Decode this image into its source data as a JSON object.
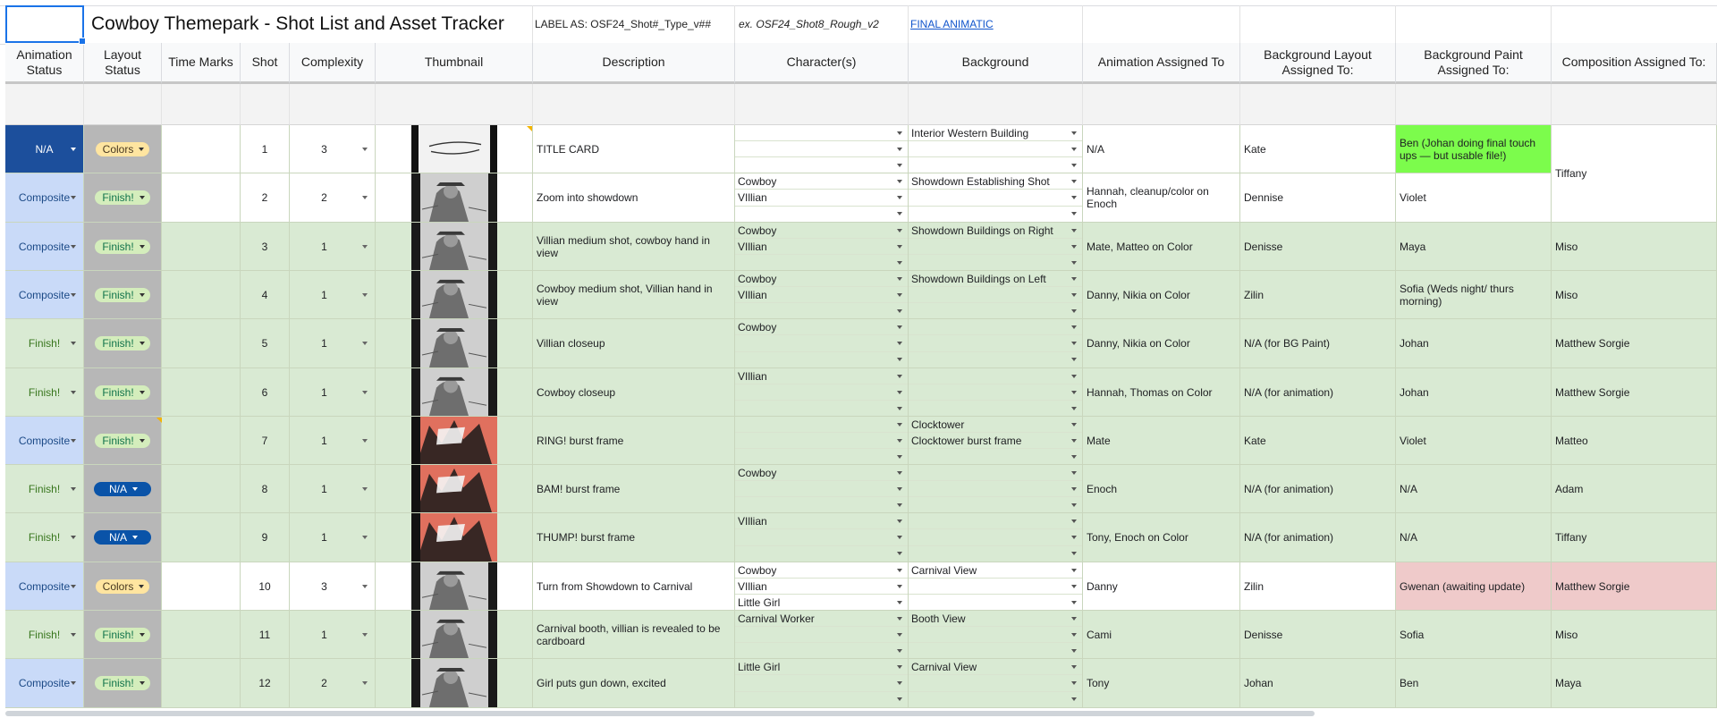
{
  "title": "Cowboy Themepark - Shot List and Asset Tracker",
  "label_as": "LABEL AS: OSF24_Shot#_Type_v##",
  "label_example": "ex. OSF24_Shot8_Rough_v2",
  "final_animatic_link": "FINAL ANIMATIC",
  "headers": {
    "animation_status": "Animation Status",
    "layout_status": "Layout Status",
    "time_marks": "Time Marks",
    "shot": "Shot",
    "complexity": "Complexity",
    "thumbnail": "Thumbnail",
    "description": "Description",
    "characters": "Character(s)",
    "background": "Background",
    "animation_assigned": "Animation Assigned To",
    "bg_layout_assigned": "Background Layout Assigned To:",
    "bg_paint_assigned": "Background Paint Assigned To:",
    "composition_assigned": "Composition Assigned To:"
  },
  "colors": {
    "composite_bg": "#c9daf8",
    "na_bg": "#1c4f9c",
    "finish_bg": "#d9ead3",
    "layout_gray": "#b7b7b7",
    "row_green": "#d9ead3",
    "highlight_green": "#7cfc4c",
    "highlight_red": "#efcaca",
    "link_blue": "#1155cc"
  },
  "rows": [
    {
      "anim_status": "N/A",
      "layout_status": "Colors",
      "time_marks": "",
      "shot": "1",
      "complexity": "3",
      "thumb_icon": "title-card-sketch",
      "description": "TITLE CARD",
      "characters": [
        "",
        "",
        ""
      ],
      "backgrounds": [
        "Interior Western Building",
        "",
        ""
      ],
      "animation": "N/A",
      "bg_layout": "Kate",
      "bg_paint": "Ben (Johan doing final touch ups — but usable file!)",
      "composition": ""
    },
    {
      "anim_status": "Composite",
      "layout_status": "Finish!",
      "time_marks": "",
      "shot": "2",
      "complexity": "2",
      "thumb_icon": "town-sketch",
      "description": "Zoom into showdown",
      "characters": [
        "Cowboy",
        "VIllian",
        ""
      ],
      "backgrounds": [
        "Showdown Establishing Shot",
        "",
        ""
      ],
      "animation": "Hannah, cleanup/color on Enoch",
      "bg_layout": "Dennise",
      "bg_paint": "Violet",
      "composition": ""
    },
    {
      "anim_status": "Composite",
      "layout_status": "Finish!",
      "time_marks": "",
      "shot": "3",
      "complexity": "1",
      "thumb_icon": "villain-medium-sketch",
      "description": "Villian medium shot, cowboy hand in view",
      "characters": [
        "Cowboy",
        "VIllian",
        ""
      ],
      "backgrounds": [
        "Showdown Buildings on Right",
        "",
        ""
      ],
      "animation": "Mate, Matteo on Color",
      "bg_layout": "Denisse",
      "bg_paint": "Maya",
      "composition": "Miso"
    },
    {
      "anim_status": "Composite",
      "layout_status": "Finish!",
      "time_marks": "",
      "shot": "4",
      "complexity": "1",
      "thumb_icon": "cowboy-medium-sketch",
      "description": "Cowboy medium shot, Villian hand in view",
      "characters": [
        "Cowboy",
        "VIllian",
        ""
      ],
      "backgrounds": [
        "Showdown Buildings on Left",
        "",
        ""
      ],
      "animation": "Danny, Nikia on Color",
      "bg_layout": "Zilin",
      "bg_paint": "Sofia (Weds night/ thurs morning)",
      "composition": "Miso"
    },
    {
      "anim_status": "Finish!",
      "layout_status": "Finish!",
      "time_marks": "",
      "shot": "5",
      "complexity": "1",
      "thumb_icon": "villain-closeup-sketch",
      "description": "Villian closeup",
      "characters": [
        "Cowboy",
        "",
        ""
      ],
      "backgrounds": [
        "",
        "",
        ""
      ],
      "animation": "Danny, Nikia on Color",
      "bg_layout": "N/A (for BG Paint)",
      "bg_paint": "Johan",
      "composition": "Matthew Sorgie"
    },
    {
      "anim_status": "Finish!",
      "layout_status": "Finish!",
      "time_marks": "",
      "shot": "6",
      "complexity": "1",
      "thumb_icon": "cowboy-closeup-sketch",
      "description": "Cowboy closeup",
      "characters": [
        "VIllian",
        "",
        ""
      ],
      "backgrounds": [
        "",
        "",
        ""
      ],
      "animation": "Hannah, Thomas on Color",
      "bg_layout": "N/A (for animation)",
      "bg_paint": "Johan",
      "composition": "Matthew Sorgie"
    },
    {
      "anim_status": "Composite",
      "layout_status": "Finish!",
      "time_marks": "",
      "shot": "7",
      "complexity": "1",
      "thumb_icon": "ring-burst-frame",
      "description": "RING! burst frame",
      "characters": [
        "",
        "",
        ""
      ],
      "backgrounds": [
        "Clocktower",
        "Clocktower burst frame",
        ""
      ],
      "animation": "Mate",
      "bg_layout": "Kate",
      "bg_paint": "Violet",
      "composition": "Matteo"
    },
    {
      "anim_status": "Finish!",
      "layout_status": "N/A",
      "time_marks": "",
      "shot": "8",
      "complexity": "1",
      "thumb_icon": "bam-burst-frame",
      "description": "BAM! burst frame",
      "characters": [
        "Cowboy",
        "",
        ""
      ],
      "backgrounds": [
        "",
        "",
        ""
      ],
      "animation": "Enoch",
      "bg_layout": "N/A (for animation)",
      "bg_paint": "N/A",
      "composition": "Adam"
    },
    {
      "anim_status": "Finish!",
      "layout_status": "N/A",
      "time_marks": "",
      "shot": "9",
      "complexity": "1",
      "thumb_icon": "thump-burst-frame",
      "description": "THUMP! burst frame",
      "characters": [
        "VIllian",
        "",
        ""
      ],
      "backgrounds": [
        "",
        "",
        ""
      ],
      "animation": "Tony, Enoch on Color",
      "bg_layout": "N/A (for animation)",
      "bg_paint": "N/A",
      "composition": "Tiffany"
    },
    {
      "anim_status": "Composite",
      "layout_status": "Colors",
      "time_marks": "",
      "shot": "10",
      "complexity": "3",
      "thumb_icon": "carnival-turn-sketch",
      "description": "Turn from Showdown to Carnival",
      "characters": [
        "Cowboy",
        "VIllian",
        "Little Girl"
      ],
      "backgrounds": [
        "Carnival View",
        "",
        ""
      ],
      "animation": "Danny",
      "bg_layout": "Zilin",
      "bg_paint": "Gwenan (awaiting update)",
      "composition": "Matthew Sorgie"
    },
    {
      "anim_status": "Finish!",
      "layout_status": "Finish!",
      "time_marks": "",
      "shot": "11",
      "complexity": "1",
      "thumb_icon": "carnival-booth-sketch",
      "description": "Carnival booth, villian is revealed to be cardboard",
      "characters": [
        "Carnival Worker",
        "",
        ""
      ],
      "backgrounds": [
        "Booth View",
        "",
        ""
      ],
      "animation": "Cami",
      "bg_layout": "Denisse",
      "bg_paint": "Sofia",
      "composition": "Miso"
    },
    {
      "anim_status": "Composite",
      "layout_status": "Finish!",
      "time_marks": "",
      "shot": "12",
      "complexity": "2",
      "thumb_icon": "girl-gun-sketch",
      "description": "Girl puts gun down, excited",
      "characters": [
        "Little Girl",
        "",
        ""
      ],
      "backgrounds": [
        "Carnival View",
        "",
        ""
      ],
      "animation": "Tony",
      "bg_layout": "Johan",
      "bg_paint": "Ben",
      "composition": "Maya"
    }
  ],
  "merged_composition_1_2": "Tiffany"
}
